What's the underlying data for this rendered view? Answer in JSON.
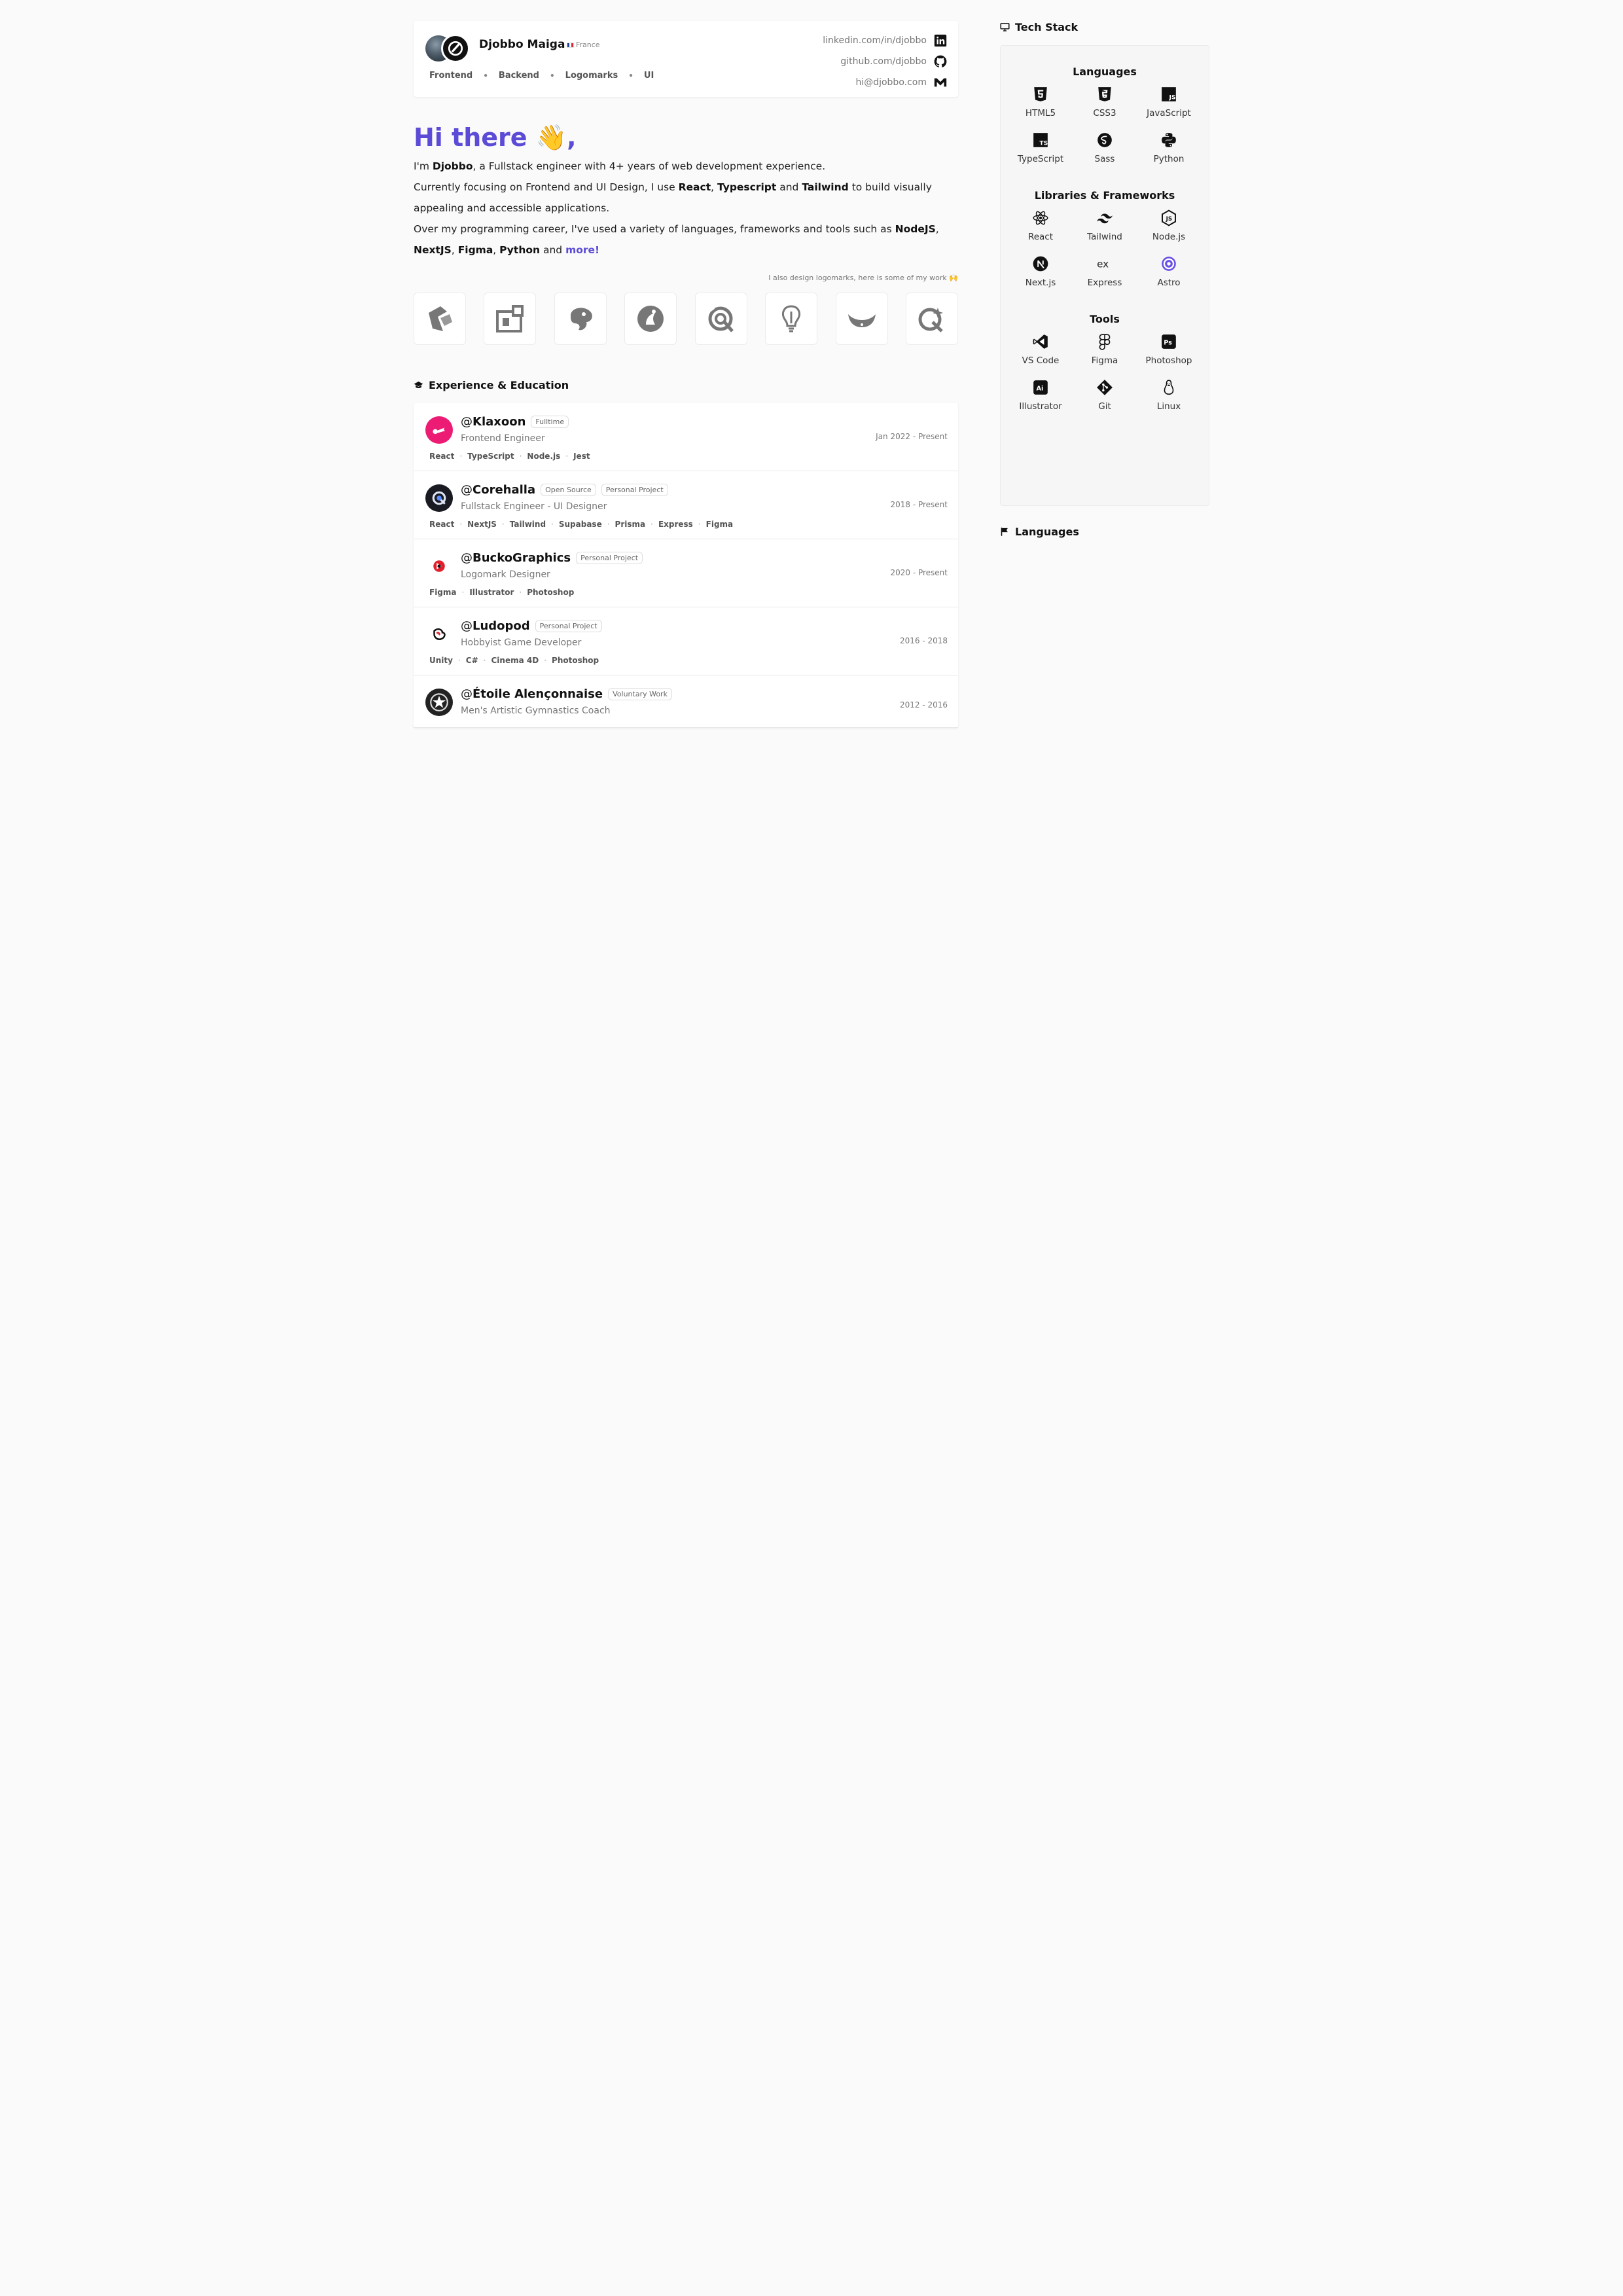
{
  "profile": {
    "name": "Djobbo Maiga",
    "country": "France",
    "roles": [
      "Frontend",
      "Backend",
      "Logomarks",
      "UI"
    ],
    "contacts": {
      "linkedin": "linkedin.com/in/djobbo",
      "github": "github.com/djobbo",
      "email": "hi@djobbo.com"
    }
  },
  "intro": {
    "greeting": "Hi there 👋,",
    "p1": {
      "a": "I'm ",
      "name": "Djobbo",
      "b": ", a Fullstack engineer with 4+ years of web development experience."
    },
    "p2": {
      "a": "Currently focusing on Frontend and UI Design, I use ",
      "t1": "React",
      "s1": ", ",
      "t2": "Typescript",
      "s2": " and ",
      "t3": "Tailwind",
      "b": " to build visually appealing and accessible applications."
    },
    "p3": {
      "a": "Over my programming career, I've used a variety of languages, frameworks and tools such as ",
      "t1": "NodeJS",
      "s1": ", ",
      "t2": "NextJS",
      "s2": ", ",
      "t3": "Figma",
      "s3": ", ",
      "t4": "Python",
      "s4": " and ",
      "more": "more!"
    }
  },
  "logomarks": {
    "note": "I also design logomarks, here is some of my work 🙌",
    "items": [
      "logomark-1",
      "logomark-2",
      "logomark-3",
      "logomark-4",
      "logomark-5",
      "logomark-6",
      "logomark-7",
      "logomark-8"
    ]
  },
  "experience": {
    "title": "Experience & Education",
    "items": [
      {
        "at": "@",
        "name": "Klaxoon",
        "tags": [
          "Fulltime"
        ],
        "role": "Frontend Engineer",
        "date": "Jan 2022 - Present",
        "tech": [
          "React",
          "TypeScript",
          "Node.js",
          "Jest"
        ]
      },
      {
        "at": "@",
        "name": "Corehalla",
        "tags": [
          "Open Source",
          "Personal Project"
        ],
        "role": "Fullstack Engineer - UI Designer",
        "date": "2018 - Present",
        "tech": [
          "React",
          "NextJS",
          "Tailwind",
          "Supabase",
          "Prisma",
          "Express",
          "Figma"
        ]
      },
      {
        "at": "@",
        "name": "BuckoGraphics",
        "tags": [
          "Personal Project"
        ],
        "role": "Logomark Designer",
        "date": "2020 - Present",
        "tech": [
          "Figma",
          "Illustrator",
          "Photoshop"
        ]
      },
      {
        "at": "@",
        "name": "Ludopod",
        "tags": [
          "Personal Project"
        ],
        "role": "Hobbyist Game Developer",
        "date": "2016 - 2018",
        "tech": [
          "Unity",
          "C#",
          "Cinema 4D",
          "Photoshop"
        ]
      },
      {
        "at": "@",
        "name": "Étoile Alençonnaise",
        "tags": [
          "Voluntary Work"
        ],
        "role": "Men's Artistic Gymnastics Coach",
        "date": "2012 - 2016",
        "tech": []
      }
    ]
  },
  "tech_stack": {
    "title": "Tech Stack",
    "groups": [
      {
        "title": "Languages",
        "items": [
          "HTML5",
          "CSS3",
          "JavaScript",
          "TypeScript",
          "Sass",
          "Python"
        ]
      },
      {
        "title": "Libraries & Frameworks",
        "items": [
          "React",
          "Tailwind",
          "Node.js",
          "Next.js",
          "Express",
          "Astro"
        ]
      },
      {
        "title": "Tools",
        "items": [
          "VS Code",
          "Figma",
          "Photoshop",
          "Illustrator",
          "Git",
          "Linux"
        ]
      }
    ]
  },
  "languages": {
    "title": "Languages"
  },
  "colors": {
    "accent": "#5b4bd6",
    "klaxoon": "#ec1c74",
    "background": "#fafafa"
  }
}
